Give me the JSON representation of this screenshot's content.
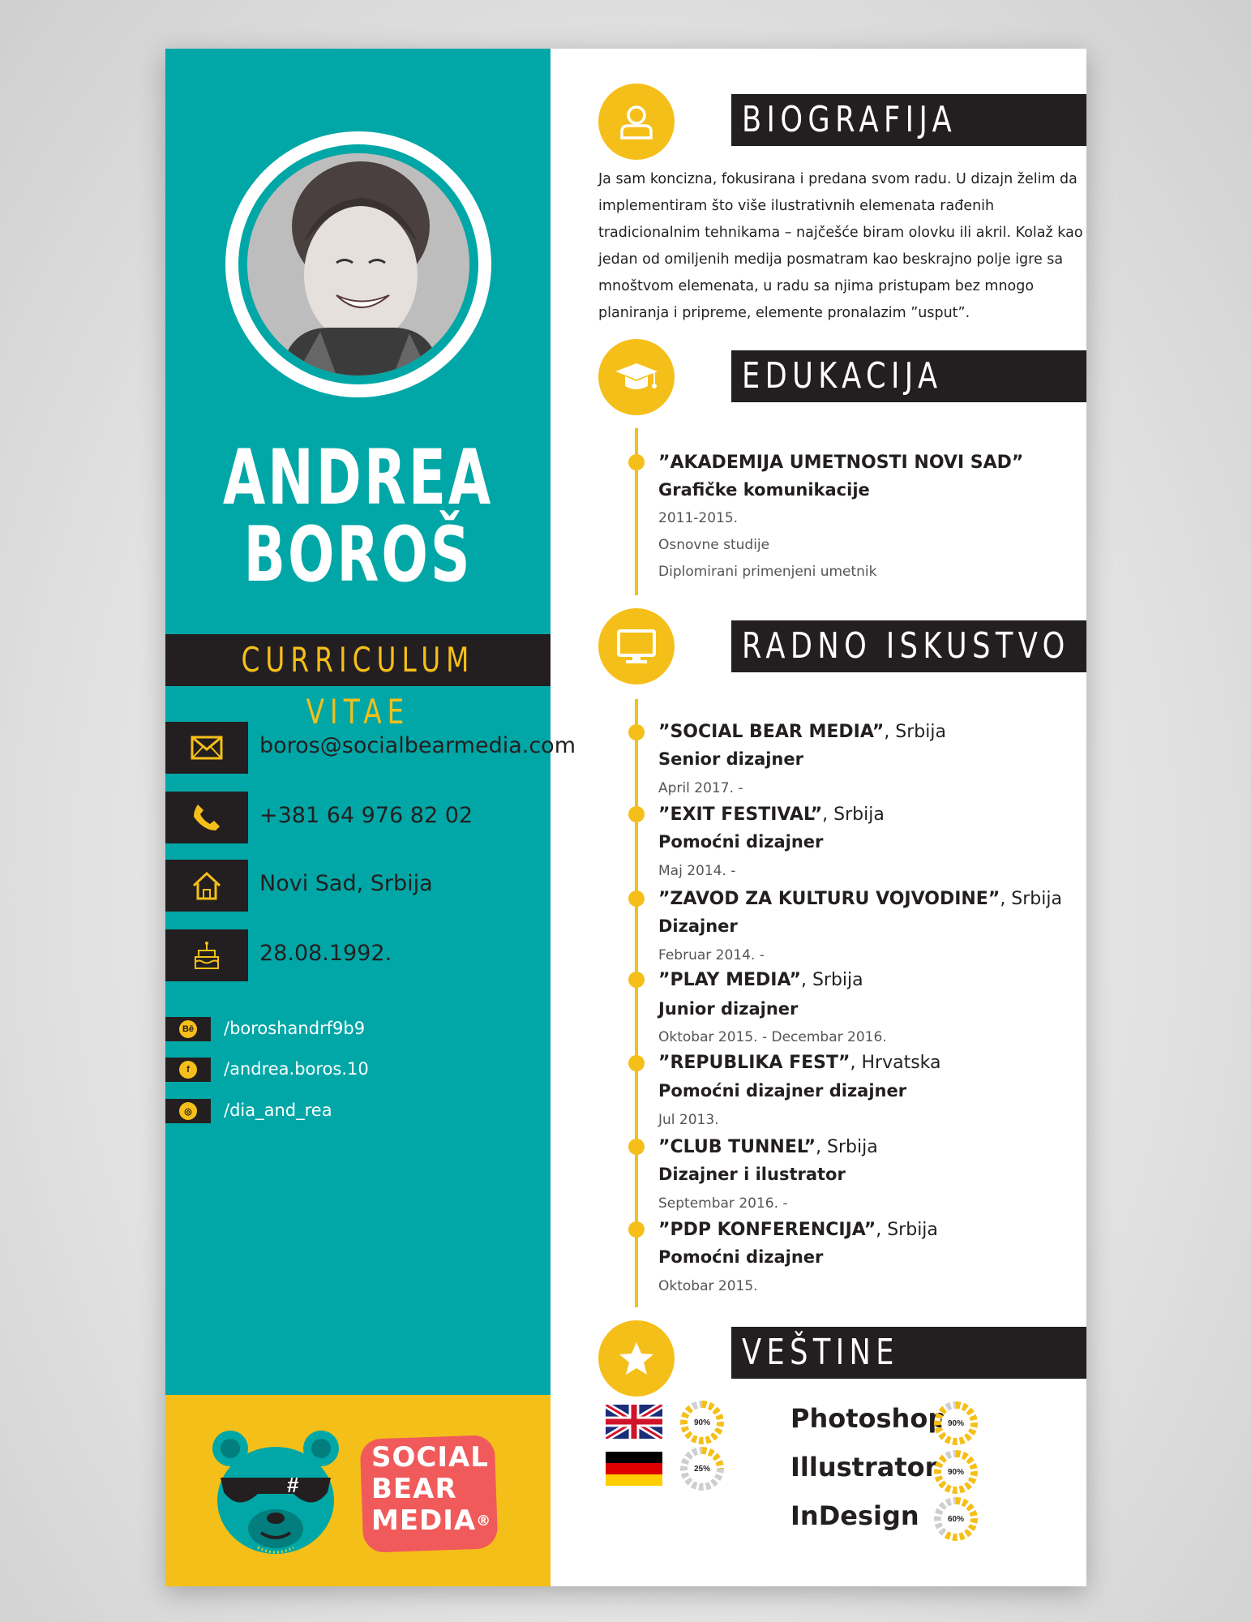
{
  "profile": {
    "first_name": "ANDREA",
    "last_name": "BOROŠ",
    "subtitle": "CURRICULUM VITAE"
  },
  "contact": {
    "email": "boros@socialbearmedia.com",
    "phone": "+381 64 976 82 02",
    "location": "Novi Sad, Srbija",
    "birthdate": "28.08.1992."
  },
  "social": {
    "behance": "/boroshandrf9b9",
    "facebook": "/andrea.boros.10",
    "instagram": "/dia_and_rea",
    "behance_glyph": "Bē",
    "facebook_glyph": "f",
    "instagram_glyph": "◎"
  },
  "logo": {
    "line1": "SOCIAL",
    "line2": "BEAR",
    "line3": "MEDIA",
    "mark": "®"
  },
  "sections": {
    "bio": "BIOGRAFIJA",
    "education": "EDUKACIJA",
    "work": "RADNO ISKUSTVO",
    "skills": "VEŠTINE"
  },
  "bio_text": "Ja sam koncizna, fokusirana i predana svom radu. U dizajn želim da implementiram što više ilustrativnih elemenata rađenih tradicionalnim tehnikama – najčešće biram olovku ili akril. Kolaž kao jedan od omiljenih medija posmatram kao beskrajno polje igre sa mnoštvom elemenata, u radu sa njima pristupam bez mnogo planiranja i pripreme, elemente pronalazim ”usput”.",
  "education": {
    "school": "”AKADEMIJA UMETNOSTI NOVI SAD”",
    "program": "Grafičke komunikacije",
    "years": "2011-2015.",
    "level": "Osnovne studije",
    "degree": "Diplomirani primenjeni umetnik"
  },
  "work": [
    {
      "company": "”SOCIAL BEAR MEDIA”",
      "country": ", Srbija",
      "role": "Senior dizajner",
      "date": "April 2017. -"
    },
    {
      "company": "”EXIT FESTIVAL”",
      "country": ", Srbija",
      "role": "Pomoćni dizajner",
      "date": "Maj 2014. -"
    },
    {
      "company": "”ZAVOD ZA KULTURU VOJVODINE”",
      "country": ", Srbija",
      "role": "Dizajner",
      "date": "Februar 2014. -"
    },
    {
      "company": "”PLAY MEDIA”",
      "country": ", Srbija",
      "role": "Junior dizajner",
      "date": "Oktobar 2015. - Decembar 2016."
    },
    {
      "company": "”REPUBLIKA FEST”",
      "country": ", Hrvatska",
      "role": "Pomoćni dizajner dizajner",
      "date": "Jul 2013."
    },
    {
      "company": "”CLUB TUNNEL”",
      "country": ", Srbija",
      "role": "Dizajner i ilustrator",
      "date": "Septembar 2016. -"
    },
    {
      "company": "”PDP KONFERENCIJA”",
      "country": ", Srbija",
      "role": "Pomoćni dizajner",
      "date": "Oktobar 2015."
    }
  ],
  "languages": [
    {
      "flag": "uk-flag-icon",
      "level": "90%",
      "value": 0.9
    },
    {
      "flag": "germany-flag-icon",
      "level": "25%",
      "value": 0.25
    }
  ],
  "skills": [
    {
      "name": "Photoshop",
      "level": "90%",
      "value": 0.9
    },
    {
      "name": "Illustrator",
      "level": "90%",
      "value": 0.9
    },
    {
      "name": "InDesign",
      "level": "60%",
      "value": 0.6
    }
  ],
  "colors": {
    "teal": "#00a7a6",
    "yellow": "#f5bf19",
    "dark": "#231f20",
    "coral": "#f15a5a"
  }
}
